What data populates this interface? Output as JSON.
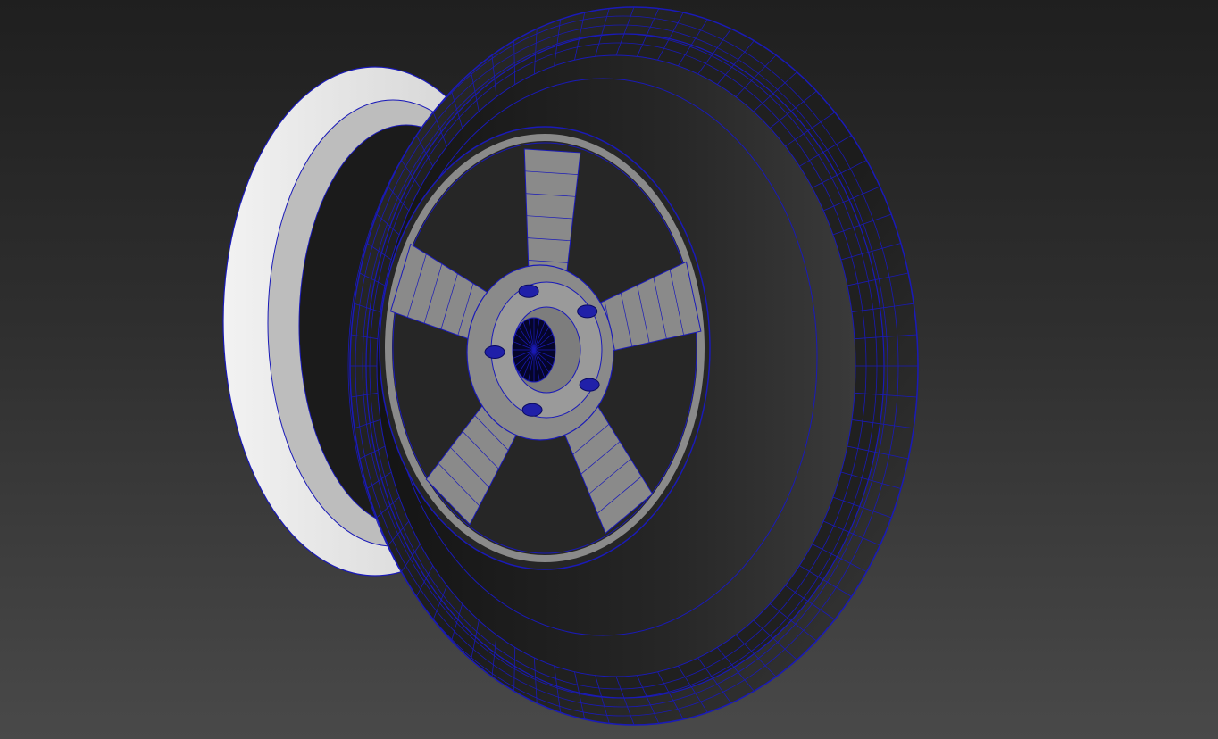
{
  "viewport": {
    "background_top": "#1f1f1f",
    "background_bottom": "#494949"
  },
  "model": {
    "object": "wheel-rim-mesh",
    "display_mode": "shaded-with-wireframe",
    "wire_color": "#1a1ab8",
    "back_rim_color": "#e6e6e6",
    "barrel_color": "#2a2a2a",
    "face_color": "#8a8a8a",
    "spoke_count": 5,
    "lug_count": 5
  }
}
